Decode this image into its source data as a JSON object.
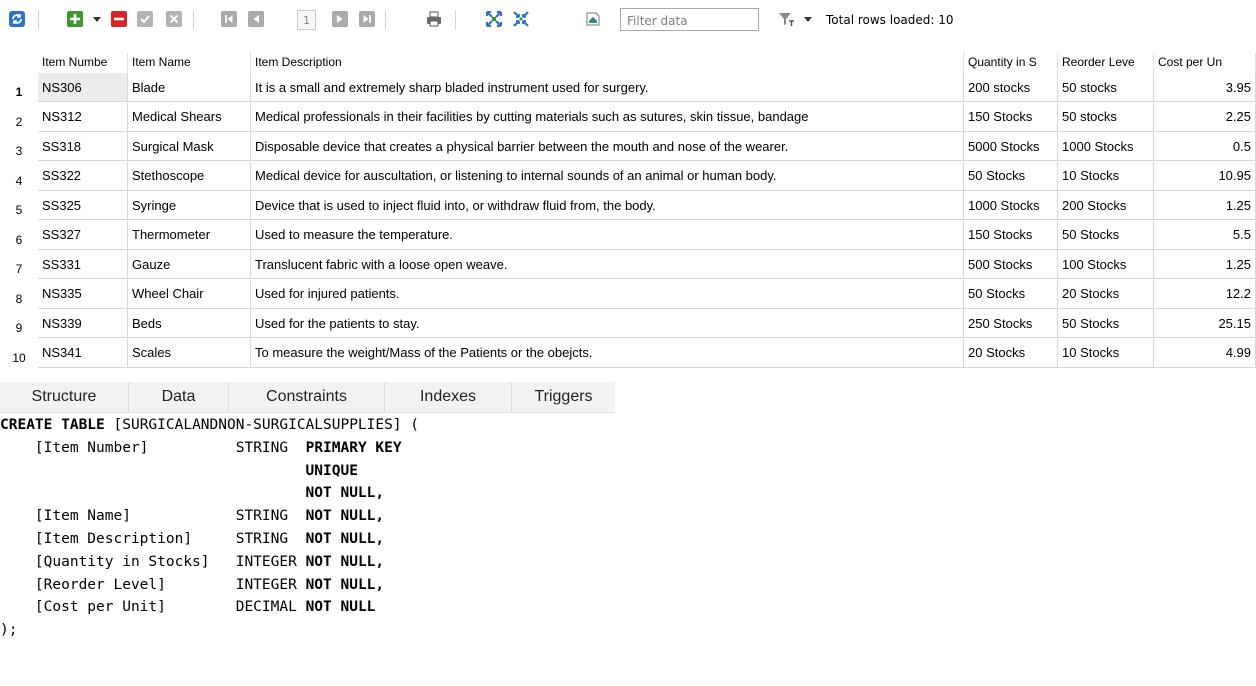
{
  "toolbar": {
    "icons": [
      "refresh-icon",
      "add-row-icon",
      "dropdown-arrow-icon",
      "delete-row-icon",
      "commit-icon",
      "rollback-icon",
      "first-page-icon",
      "previous-page-icon",
      "next-page-icon",
      "last-page-icon",
      "print-icon",
      "expand-icon",
      "collapse-icon",
      "export-icon",
      "filter-icon"
    ],
    "page_number": "1",
    "filter_placeholder": "Filter data",
    "rows_loaded": "Total rows loaded: 10"
  },
  "colors": {
    "green": "#3a9b2a",
    "red": "#d4252b",
    "blue": "#2f73c8",
    "gray": "#a8a8a8"
  },
  "grid": {
    "columns": [
      "Item Numbe",
      "Item Name",
      "Item Description",
      "Quantity in S",
      "Reorder Leve",
      "Cost per Un"
    ],
    "rows": [
      {
        "n": "1",
        "cells": [
          "NS306",
          "Blade",
          "It is a small and extremely sharp bladed instrument used for surgery.",
          "200 stocks",
          "50 stocks",
          "3.95"
        ]
      },
      {
        "n": "2",
        "cells": [
          "NS312",
          "Medical Shears",
          "Medical professionals in their facilities by cutting materials such as sutures, skin tissue, bandage",
          "150 Stocks",
          "50 stocks",
          "2.25"
        ]
      },
      {
        "n": "3",
        "cells": [
          "SS318",
          "Surgical Mask",
          "Disposable device that creates a physical barrier between the mouth and nose of the wearer.",
          "5000 Stocks",
          "1000 Stocks",
          "0.5"
        ]
      },
      {
        "n": "4",
        "cells": [
          "SS322",
          "Stethoscope",
          "Medical device for auscultation, or listening to internal sounds of an animal or human body.",
          "50 Stocks",
          "10 Stocks",
          "10.95"
        ]
      },
      {
        "n": "5",
        "cells": [
          "SS325",
          "Syringe",
          "Device that is used to inject fluid into, or withdraw fluid from, the body.",
          "1000 Stocks",
          "200 Stocks",
          "1.25"
        ]
      },
      {
        "n": "6",
        "cells": [
          "SS327",
          "Thermometer",
          "Used to measure the temperature.",
          "150 Stocks",
          "50 Stocks",
          "5.5"
        ]
      },
      {
        "n": "7",
        "cells": [
          "SS331",
          "Gauze",
          "Translucent fabric with a loose open weave.",
          "500 Stocks",
          "100 Stocks",
          "1.25"
        ]
      },
      {
        "n": "8",
        "cells": [
          "NS335",
          "Wheel Chair",
          "Used for injured patients.",
          "50 Stocks",
          "20 Stocks",
          "12.2"
        ]
      },
      {
        "n": "9",
        "cells": [
          "NS339",
          "Beds",
          "Used for the patients to stay.",
          "250 Stocks",
          "50 Stocks",
          "25.15"
        ]
      },
      {
        "n": "10",
        "cells": [
          "NS341",
          "Scales",
          "To measure the weight/Mass of the Patients or the obejcts.",
          "20 Stocks",
          "10 Stocks",
          "4.99"
        ]
      }
    ]
  },
  "tabs": [
    "Structure",
    "Data",
    "Constraints",
    "Indexes",
    "Triggers"
  ],
  "ddl": {
    "create": "CREATE TABLE",
    "table_name": "[SURGICALANDNON-SURGICALSUPPLIES] (",
    "fields": [
      {
        "name": "[Item Number]",
        "type": "STRING",
        "constraints": [
          "PRIMARY KEY",
          "UNIQUE",
          "NOT NULL,"
        ]
      },
      {
        "name": "[Item Name]",
        "type": "STRING",
        "constraints": [
          "NOT NULL,"
        ]
      },
      {
        "name": "[Item Description]",
        "type": "STRING",
        "constraints": [
          "NOT NULL,"
        ]
      },
      {
        "name": "[Quantity in Stocks]",
        "type": "INTEGER",
        "constraints": [
          "NOT NULL,"
        ]
      },
      {
        "name": "[Reorder Level]",
        "type": "INTEGER",
        "constraints": [
          "NOT NULL,"
        ]
      },
      {
        "name": "[Cost per Unit]",
        "type": "DECIMAL",
        "constraints": [
          "NOT NULL"
        ]
      }
    ],
    "close": ");"
  }
}
